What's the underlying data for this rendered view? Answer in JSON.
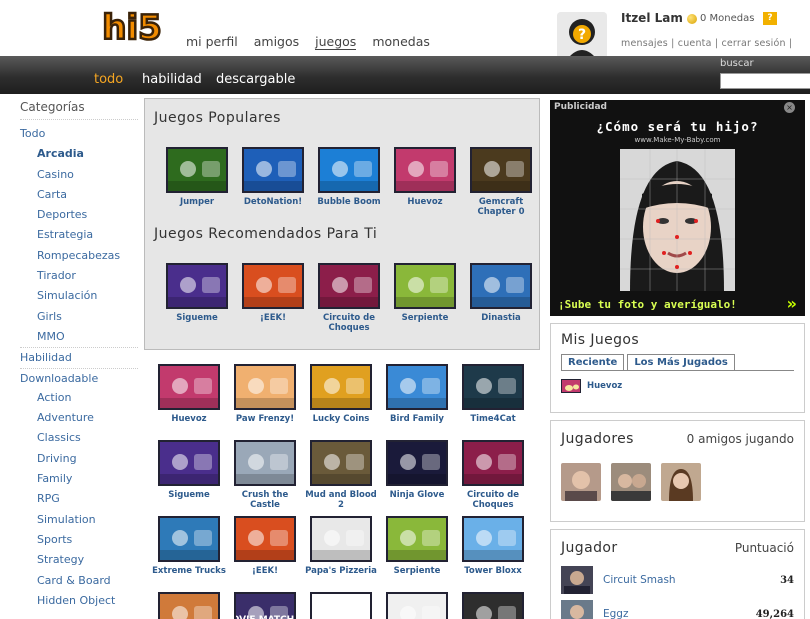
{
  "header": {
    "logo_text": "hi5",
    "nav": [
      "mi perfil",
      "amigos",
      "juegos",
      "monedas"
    ],
    "user": {
      "name": "Itzel Lam",
      "coins": "0 Monedas",
      "help": "?",
      "links": "mensajes | cuenta | cerrar sesión |"
    }
  },
  "subnav": {
    "items": [
      "todo",
      "habilidad",
      "descargable"
    ],
    "search_label": "buscar",
    "search_value": ""
  },
  "sidebar": {
    "heading": "Categorías",
    "items": [
      {
        "label": "Todo"
      },
      {
        "label": "Arcadia"
      },
      {
        "label": "Casino"
      },
      {
        "label": "Carta"
      },
      {
        "label": "Deportes"
      },
      {
        "label": "Estrategia"
      },
      {
        "label": "Rompecabezas"
      },
      {
        "label": "Tirador"
      },
      {
        "label": "Simulación"
      },
      {
        "label": "Girls"
      },
      {
        "label": "MMO"
      },
      {
        "label": "Habilidad"
      },
      {
        "label": "Downloadable"
      },
      {
        "label": "Action"
      },
      {
        "label": "Adventure"
      },
      {
        "label": "Classics"
      },
      {
        "label": "Driving"
      },
      {
        "label": "Family"
      },
      {
        "label": "RPG"
      },
      {
        "label": "Simulation"
      },
      {
        "label": "Sports"
      },
      {
        "label": "Strategy"
      },
      {
        "label": "Card & Board"
      },
      {
        "label": "Hidden Object"
      }
    ]
  },
  "featured": {
    "popular_title": "Juegos Populares",
    "popular": [
      {
        "title": "Jumper",
        "color": "#2e6b1e"
      },
      {
        "title": "DetoNation!",
        "color": "#1e5fb8"
      },
      {
        "title": "Bubble Boom",
        "color": "#1c7fd6"
      },
      {
        "title": "Huevoz",
        "color": "#c23a6d"
      },
      {
        "title": "Gemcraft Chapter 0",
        "color": "#4b3a1e"
      }
    ],
    "recommended_title": "Juegos Recomendados Para Ti",
    "recommended": [
      {
        "title": "Sigueme",
        "color": "#4a2e8c"
      },
      {
        "title": "¡EEK!",
        "color": "#d94e1f"
      },
      {
        "title": "Circuito de Choques",
        "color": "#8c1e4a"
      },
      {
        "title": "Serpiente",
        "color": "#8ab83a"
      },
      {
        "title": "Dinastia",
        "color": "#2e6fb8"
      }
    ]
  },
  "grid": [
    [
      {
        "title": "Huevoz",
        "color": "#c23a6d"
      },
      {
        "title": "Paw Frenzy!",
        "color": "#f0b070"
      },
      {
        "title": "Lucky Coins",
        "color": "#e0a020"
      },
      {
        "title": "Bird Family",
        "color": "#3a8ad6"
      },
      {
        "title": "Time4Cat",
        "color": "#1e3a4a"
      }
    ],
    [
      {
        "title": "Sigueme",
        "color": "#4a2e8c"
      },
      {
        "title": "Crush the Castle",
        "color": "#9aa8b8"
      },
      {
        "title": "Mud and Blood 2",
        "color": "#6a5a3a"
      },
      {
        "title": "Ninja Glove",
        "color": "#1a1a3a"
      },
      {
        "title": "Circuito de Choques",
        "color": "#8c1e4a"
      }
    ],
    [
      {
        "title": "Extreme Trucks",
        "color": "#2e7ab8"
      },
      {
        "title": "¡EEK!",
        "color": "#d94e1f"
      },
      {
        "title": "Papa's Pizzeria",
        "color": "#e8e8e8"
      },
      {
        "title": "Serpiente",
        "color": "#8ab83a"
      },
      {
        "title": "Tower Bloxx",
        "color": "#6ab0e8"
      }
    ],
    [
      {
        "title": "",
        "color": "#d07a3a"
      },
      {
        "title": "",
        "color": "#3a2e6a",
        "text": "MOVIE MATCH UP"
      },
      {
        "title": "",
        "color": "#ffffff"
      },
      {
        "title": "",
        "color": "#f0f0f0"
      },
      {
        "title": "",
        "color": "#2e2e2e"
      }
    ]
  ],
  "ad": {
    "label": "Publicidad",
    "close": "×",
    "question": "¿Cómo será tu hijo?",
    "url": "www.Make-My-Baby.com",
    "cta": "¡Sube tu foto y averígualo!",
    "arrow": "»"
  },
  "mis_juegos": {
    "title": "Mis Juegos",
    "tabs": [
      "Reciente",
      "Los Más Jugados"
    ],
    "items": [
      {
        "title": "Huevoz",
        "color": "#c23a6d"
      }
    ]
  },
  "jugadores": {
    "title": "Jugadores",
    "subtitle": "0 amigos jugando"
  },
  "jugador": {
    "title": "Jugador",
    "score_label": "Puntuació",
    "rows": [
      {
        "game": "Circuit Smash",
        "score": "34"
      },
      {
        "game": "Eggz",
        "score": "49,264"
      }
    ]
  }
}
